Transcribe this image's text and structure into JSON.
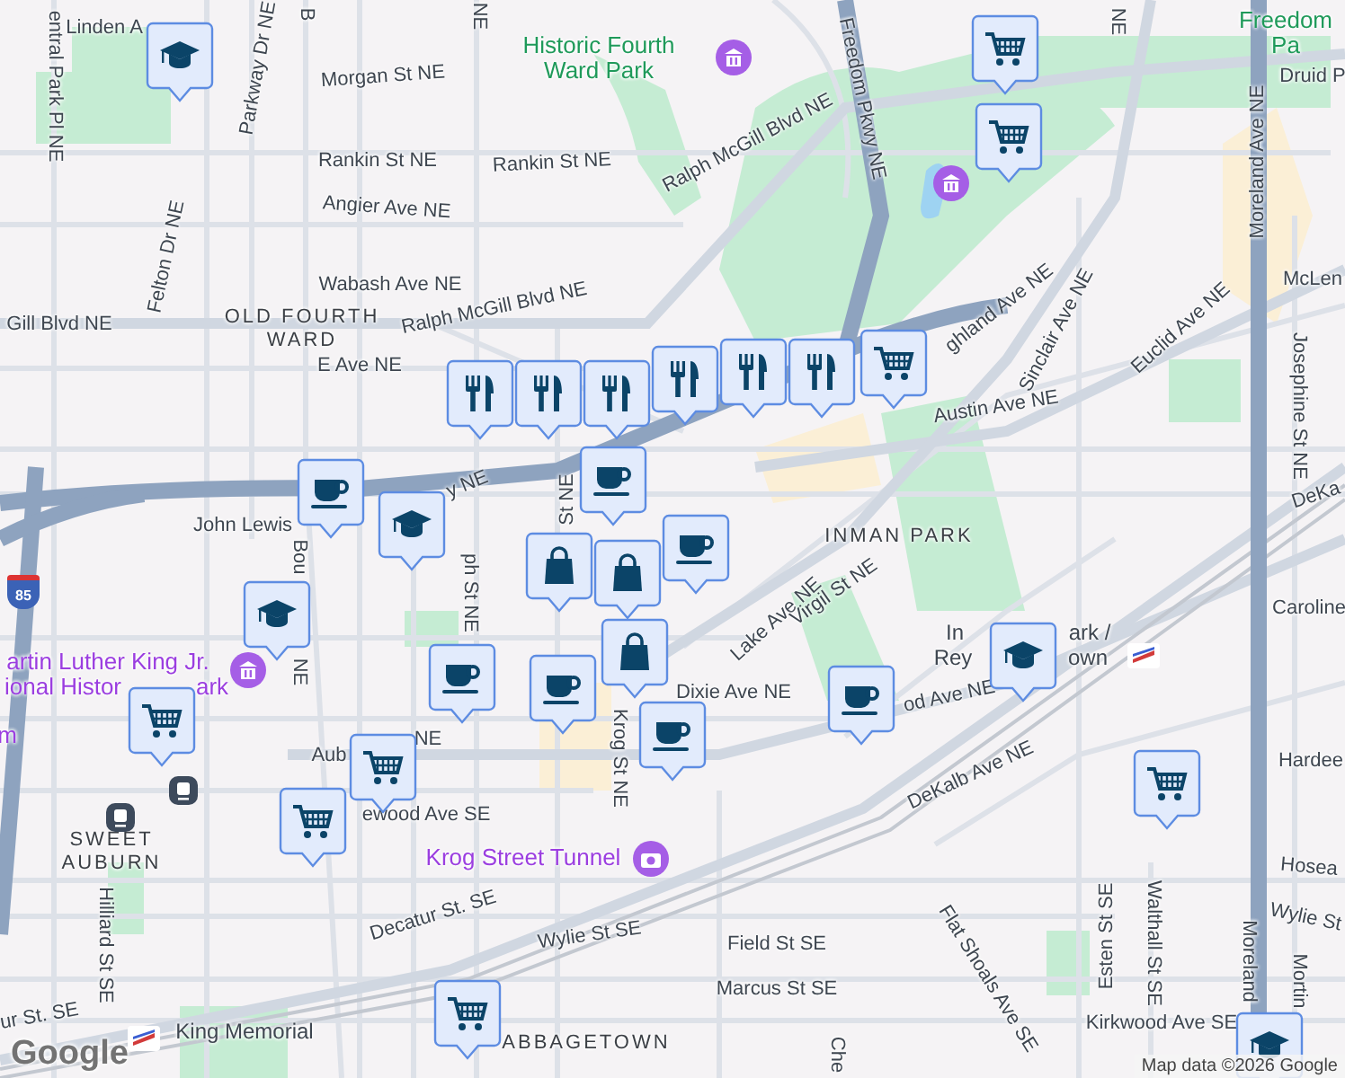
{
  "labels": [
    {
      "text": "entral Park Pl NE",
      "kind": "street"
    },
    {
      "text": "Linden A",
      "kind": "street"
    },
    {
      "text": "Parkway Dr NE",
      "kind": "street"
    },
    {
      "text": "B",
      "kind": "street"
    },
    {
      "text": "NE",
      "kind": "street"
    },
    {
      "text": "Morgan St NE",
      "kind": "street"
    },
    {
      "text": "Rankin St NE",
      "kind": "street"
    },
    {
      "text": "Rankin St NE",
      "kind": "street"
    },
    {
      "text": "Angier Ave NE",
      "kind": "street"
    },
    {
      "text": "Felton Dr NE",
      "kind": "street"
    },
    {
      "text": "Wabash Ave NE",
      "kind": "street"
    },
    {
      "text": "Gill Blvd NE",
      "kind": "street"
    },
    {
      "text": "OLD FOURTH WARD",
      "kind": "district"
    },
    {
      "text": "Ralph McGill Blvd NE",
      "kind": "street"
    },
    {
      "text": "E Ave NE",
      "kind": "street"
    },
    {
      "text": "Historic Fourth Ward Park",
      "kind": "park"
    },
    {
      "text": "Ralph McGill Blvd NE",
      "kind": "street"
    },
    {
      "text": "Freedom Pkwy NE",
      "kind": "street"
    },
    {
      "text": "NE",
      "kind": "street"
    },
    {
      "text": "Freedom Pa",
      "kind": "park"
    },
    {
      "text": "Druid P",
      "kind": "street"
    },
    {
      "text": "Moreland Ave NE",
      "kind": "street"
    },
    {
      "text": "McLen",
      "kind": "street"
    },
    {
      "text": "ghland Ave NE",
      "kind": "street"
    },
    {
      "text": "Sinclair Ave NE",
      "kind": "street"
    },
    {
      "text": "Euclid Ave NE",
      "kind": "street"
    },
    {
      "text": "Josephine St NE",
      "kind": "street"
    },
    {
      "text": "Austin Ave NE",
      "kind": "street"
    },
    {
      "text": "DeKa",
      "kind": "street"
    },
    {
      "text": "INMAN PARK",
      "kind": "district"
    },
    {
      "text": "John Lewis",
      "kind": "street"
    },
    {
      "text": "y NE",
      "kind": "street"
    },
    {
      "text": "St NE",
      "kind": "street"
    },
    {
      "text": "Bou",
      "kind": "street"
    },
    {
      "text": "NE",
      "kind": "street"
    },
    {
      "text": "ph St NE",
      "kind": "street"
    },
    {
      "text": "Lake Ave NE",
      "kind": "street"
    },
    {
      "text": "Virgil St NE",
      "kind": "street"
    },
    {
      "text": "Caroline",
      "kind": "street"
    },
    {
      "text": "artin Luther King Jr.",
      "kind": "poi"
    },
    {
      "text": "ional Histor",
      "kind": "poi"
    },
    {
      "text": "ark",
      "kind": "poi"
    },
    {
      "text": "m",
      "kind": "poi"
    },
    {
      "text": "Aub",
      "kind": "street"
    },
    {
      "text": "NE",
      "kind": "street"
    },
    {
      "text": "ewood Ave SE",
      "kind": "street"
    },
    {
      "text": "SWEET AUBURN",
      "kind": "district"
    },
    {
      "text": "Dixie Ave NE",
      "kind": "street"
    },
    {
      "text": "od Ave NE",
      "kind": "street"
    },
    {
      "text": "In",
      "kind": "station"
    },
    {
      "text": "ark /",
      "kind": "station"
    },
    {
      "text": "Rey",
      "kind": "station"
    },
    {
      "text": "own",
      "kind": "station"
    },
    {
      "text": "DeKalb Ave NE",
      "kind": "street"
    },
    {
      "text": "Krog St NE",
      "kind": "street"
    },
    {
      "text": "Krog Street Tunnel",
      "kind": "poi"
    },
    {
      "text": "Hardee",
      "kind": "street"
    },
    {
      "text": "Hosea",
      "kind": "street"
    },
    {
      "text": "Wylie St",
      "kind": "street"
    },
    {
      "text": "Decatur St. SE",
      "kind": "street"
    },
    {
      "text": "Wylie St SE",
      "kind": "street"
    },
    {
      "text": "Hilliard St SE",
      "kind": "street"
    },
    {
      "text": "Field St SE",
      "kind": "street"
    },
    {
      "text": "Marcus St SE",
      "kind": "street"
    },
    {
      "text": "Flat Shoals Ave SE",
      "kind": "street"
    },
    {
      "text": "Esten St SE",
      "kind": "street"
    },
    {
      "text": "Walthall St SE",
      "kind": "street"
    },
    {
      "text": "Moreland",
      "kind": "street"
    },
    {
      "text": "Mortin",
      "kind": "street"
    },
    {
      "text": "Kirkwood Ave SE",
      "kind": "street"
    },
    {
      "text": "ur St. SE",
      "kind": "street"
    },
    {
      "text": "King Memorial",
      "kind": "station"
    },
    {
      "text": "ABBAGETOWN",
      "kind": "district"
    },
    {
      "text": "Che",
      "kind": "street"
    }
  ],
  "markers": [
    {
      "kind": "restaurant"
    },
    {
      "kind": "restaurant"
    },
    {
      "kind": "restaurant"
    },
    {
      "kind": "restaurant"
    },
    {
      "kind": "restaurant"
    },
    {
      "kind": "restaurant"
    },
    {
      "kind": "school"
    },
    {
      "kind": "school"
    },
    {
      "kind": "school"
    },
    {
      "kind": "school"
    },
    {
      "kind": "school"
    },
    {
      "kind": "grocery"
    },
    {
      "kind": "grocery"
    },
    {
      "kind": "grocery"
    },
    {
      "kind": "grocery"
    },
    {
      "kind": "grocery"
    },
    {
      "kind": "grocery"
    },
    {
      "kind": "grocery"
    },
    {
      "kind": "grocery"
    },
    {
      "kind": "cafe"
    },
    {
      "kind": "cafe"
    },
    {
      "kind": "cafe"
    },
    {
      "kind": "cafe"
    },
    {
      "kind": "cafe"
    },
    {
      "kind": "cafe"
    },
    {
      "kind": "cafe"
    },
    {
      "kind": "shopping"
    },
    {
      "kind": "shopping"
    },
    {
      "kind": "shopping"
    }
  ],
  "highway_shield": "85",
  "logo": "Google",
  "attribution": "Map data ©2026 Google"
}
